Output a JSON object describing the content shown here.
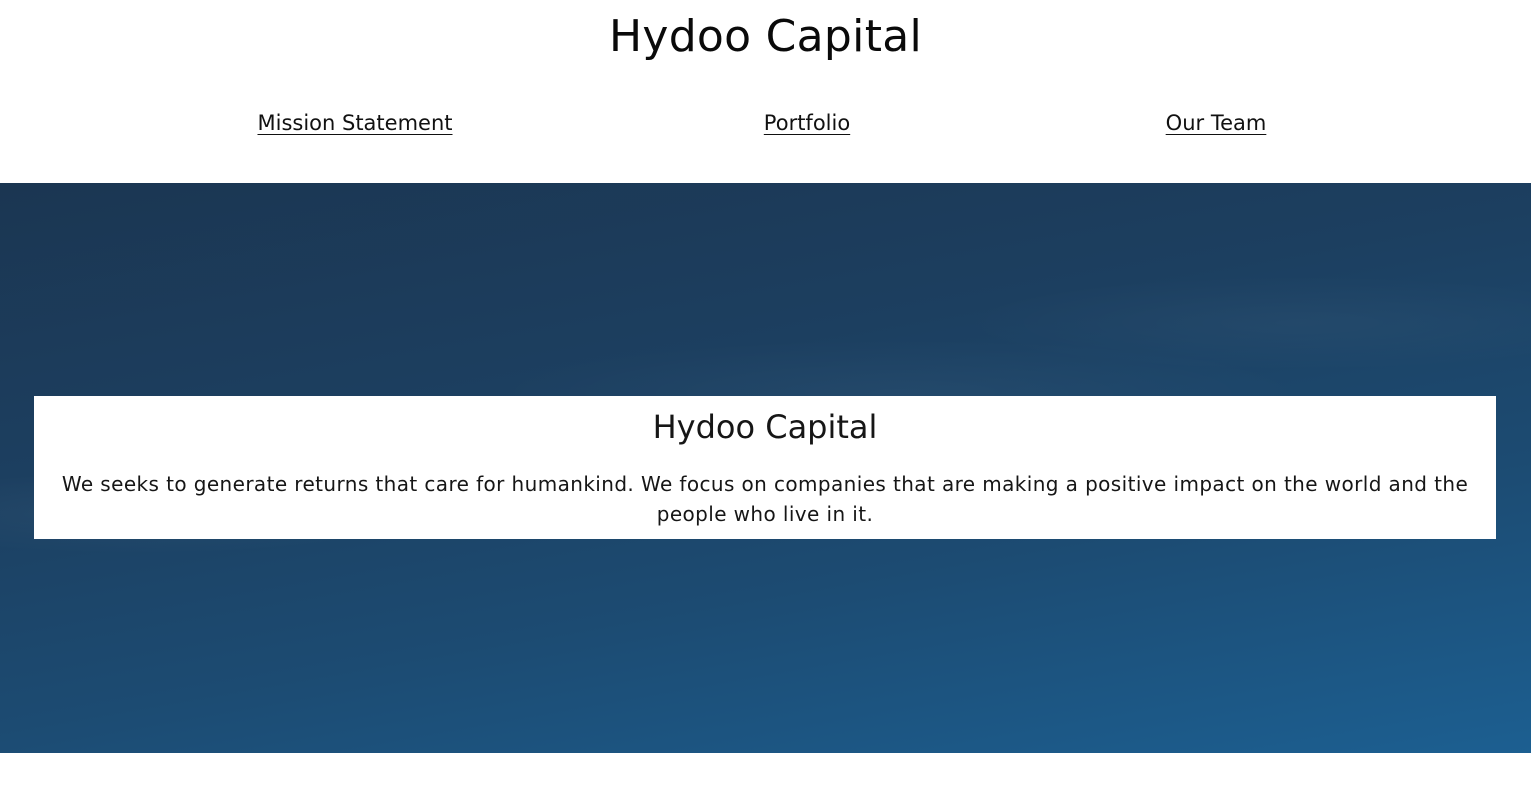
{
  "header": {
    "site_title": "Hydoo Capital"
  },
  "nav": {
    "items": [
      {
        "label": "Mission Statement"
      },
      {
        "label": "Portfolio"
      },
      {
        "label": "Our Team"
      }
    ]
  },
  "hero": {
    "card_title": "Hydoo Capital",
    "card_text": "We seeks to generate returns that care for humankind. We focus on companies that are making a positive impact on the world and the people who live in it."
  },
  "colors": {
    "hero_dark": "#1b3652",
    "hero_light": "#1c5f91",
    "card_background": "#ffffff",
    "text": "#111111"
  }
}
